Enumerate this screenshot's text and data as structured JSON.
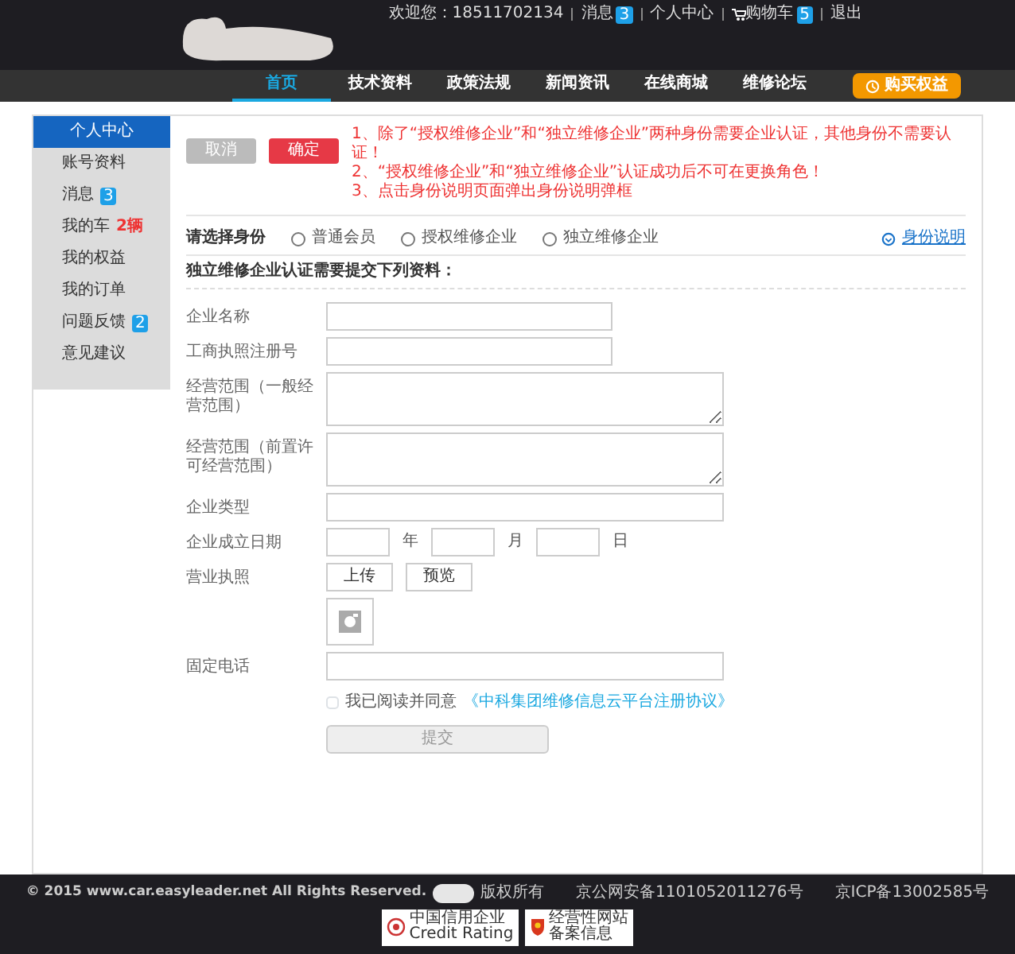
{
  "top_links": [
    {
      "kind": "text",
      "label": "欢迎您：18511702134"
    },
    {
      "kind": "link",
      "label": "消息",
      "badge": "3"
    },
    {
      "kind": "link",
      "label": "个人中心"
    },
    {
      "kind": "cart",
      "label": "购物车",
      "badge": "5"
    },
    {
      "kind": "link",
      "label": "退出"
    }
  ],
  "nav": {
    "items": [
      {
        "label": "首页",
        "selected": true
      },
      {
        "label": "技术资料",
        "selected": false
      },
      {
        "label": "政策法规",
        "selected": false
      },
      {
        "label": "新闻资讯",
        "selected": false
      },
      {
        "label": "在线商城",
        "selected": false
      },
      {
        "label": "维修论坛",
        "selected": false
      }
    ],
    "cta": "购买权益"
  },
  "sidebar": {
    "title": "个人中心",
    "items": [
      {
        "label": "账号资料"
      },
      {
        "label": "消息",
        "badge": "3"
      },
      {
        "label": "我的车",
        "note": "2辆"
      },
      {
        "label": "我的权益"
      },
      {
        "label": "我的订单"
      },
      {
        "label": "问题反馈",
        "badge": "2"
      },
      {
        "label": "意见建议"
      }
    ]
  },
  "actions": {
    "cancel": "取消",
    "confirm": "确定"
  },
  "notes": [
    "1、除了“授权维修企业”和“独立维修企业”两种身份需要企业认证，其他身份不需要认证！",
    "2、“授权维修企业”和“独立维修企业”认证成功后不可在更换角色！",
    "3、点击身份说明页面弹出身份说明弹框"
  ],
  "identity": {
    "label": "请选择身份",
    "options": [
      {
        "label": "普通会员",
        "selected": false
      },
      {
        "label": "授权维修企业",
        "selected": false
      },
      {
        "label": "独立维修企业",
        "selected": false
      }
    ],
    "help_link": "身份说明"
  },
  "section_heading": "独立维修企业认证需要提交下列资料：",
  "fields": [
    {
      "kind": "text",
      "label": "企业名称"
    },
    {
      "kind": "text",
      "label": "工商执照注册号"
    },
    {
      "kind": "textarea",
      "label": "经营范围（一般经营范围）"
    },
    {
      "kind": "textarea",
      "label": "经营范围（前置许可经营范围）"
    },
    {
      "kind": "wide",
      "label": "企业类型"
    },
    {
      "kind": "date",
      "label": "企业成立日期",
      "units": [
        "年",
        "月",
        "日"
      ]
    },
    {
      "kind": "upload",
      "label": "营业执照",
      "buttons": [
        "上传",
        "预览"
      ]
    },
    {
      "kind": "wide",
      "label": "固定电话"
    }
  ],
  "agreement": {
    "checked": false,
    "text": "我已阅读并同意",
    "link": "《中科集团维修信息云平台注册协议》"
  },
  "submit": {
    "label": "提交",
    "disabled": true
  },
  "footer": {
    "copyright": "© 2015 www.car.easyleader.net  All Rights Reserved.",
    "rights": "版权所有",
    "beian": "京公网安备1101052011276号",
    "icp": "京ICP备13002585号",
    "badges": [
      {
        "kind": "credit",
        "line1": "中国信用企业",
        "line2": "Credit Rating"
      },
      {
        "kind": "site",
        "line1": "经营性网站",
        "line2": "备案信息"
      }
    ]
  }
}
